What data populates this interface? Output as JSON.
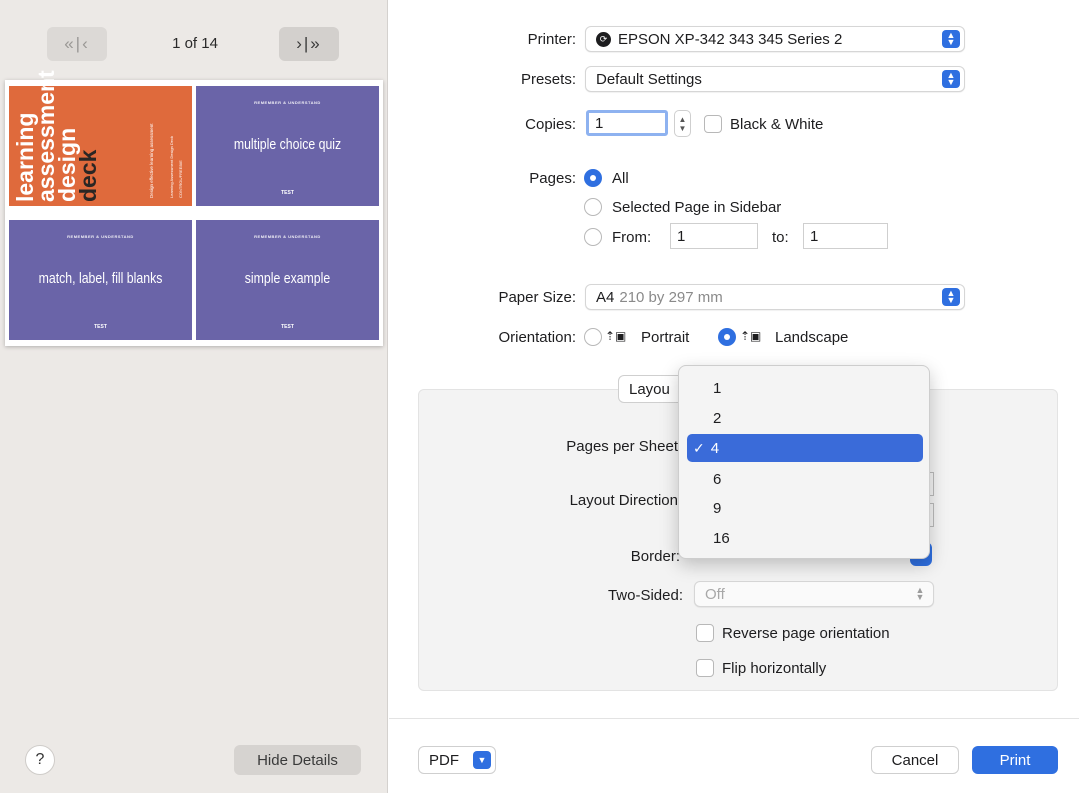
{
  "nav": {
    "first_label": "«|‹",
    "next_label": "›|»",
    "page_count": "1 of 14"
  },
  "preview": {
    "cover": {
      "title_lines": [
        "learning",
        "assessment",
        "design",
        "deck"
      ],
      "sub1": "Design effective learning assessment",
      "sub2": "Learning Assessment Design Deck",
      "sub3": "CONTROL/FREEBIE"
    },
    "thumbs": [
      {
        "small": "REMEMBER & UNDERSTAND",
        "big": "multiple choice quiz",
        "foot": "TEST"
      },
      {
        "small": "REMEMBER & UNDERSTAND",
        "big": "match, label, fill blanks",
        "foot": "TEST"
      },
      {
        "small": "REMEMBER & UNDERSTAND",
        "big": "simple example",
        "foot": "TEST"
      }
    ]
  },
  "help_label": "?",
  "hide_details_label": "Hide Details",
  "printer": {
    "label": "Printer:",
    "value": "EPSON XP-342 343 345 Series 2"
  },
  "presets": {
    "label": "Presets:",
    "value": "Default Settings"
  },
  "copies": {
    "label": "Copies:",
    "value": "1",
    "bw_label": "Black & White"
  },
  "pages": {
    "label": "Pages:",
    "all_label": "All",
    "selected_label": "Selected Page in Sidebar",
    "from_label": "From:",
    "from_value": "1",
    "to_label": "to:",
    "to_value": "1"
  },
  "paper_size": {
    "label": "Paper Size:",
    "value": "A4",
    "detail": "210 by 297 mm"
  },
  "orientation": {
    "label": "Orientation:",
    "portrait": "Portrait",
    "landscape": "Landscape",
    "selected": "Landscape"
  },
  "layout_section": {
    "tab_label": "Layou",
    "pages_per_sheet_label": "Pages per Sheet",
    "layout_direction_label": "Layout Direction",
    "border_label": "Border:",
    "two_sided_label": "Two-Sided:",
    "two_sided_value": "Off",
    "reverse_label": "Reverse page orientation",
    "flip_label": "Flip horizontally"
  },
  "dropdown": {
    "options": [
      "1",
      "2",
      "4",
      "6",
      "9",
      "16"
    ],
    "selected": "4",
    "check": "✓"
  },
  "footer": {
    "pdf_label": "PDF",
    "cancel_label": "Cancel",
    "print_label": "Print"
  },
  "colors": {
    "accent": "#2f6fe0",
    "cover": "#df6a3c",
    "thumb": "#6a64a8",
    "sidebar": "#ece9e6"
  }
}
